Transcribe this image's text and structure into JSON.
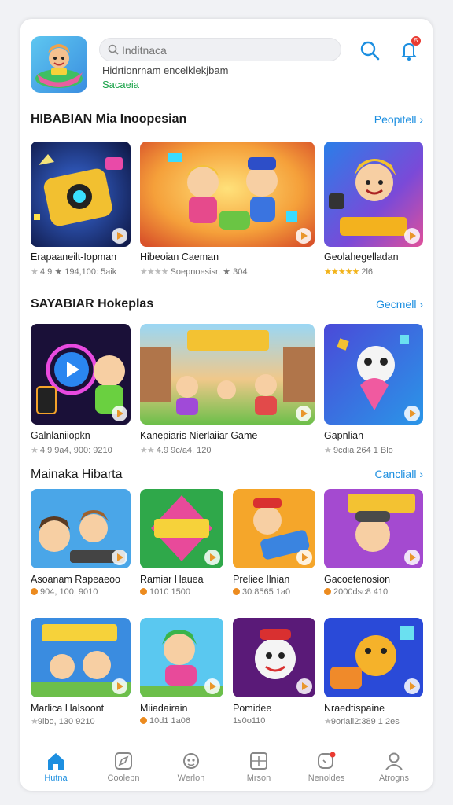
{
  "search": {
    "placeholder": "Inditnaca",
    "value": ""
  },
  "header": {
    "subtitle": "Hidrtionrnam encelklekjbam",
    "status": "Sacaeia",
    "notification_count": "5"
  },
  "sections": [
    {
      "title": "HIBABIAN Mia Inoopesian",
      "see_all": "Peopitell",
      "items": [
        {
          "name": "Erapaaneilt-Iopman",
          "meta": "4.9 ★ 194,100: 5aik"
        },
        {
          "name": "Hibeoian Caeman",
          "meta": "Soepnoesisr, ★ 304"
        },
        {
          "name": "Geolahegelladan",
          "meta": "2l6"
        }
      ]
    },
    {
      "title": "SAYABIAR Hokeplas",
      "see_all": "Gecmell",
      "items": [
        {
          "name": "Galnlaniiopkn",
          "meta": "4.9 9a4, 900: 9210"
        },
        {
          "name": "Kanepiaris Nierlaiiar Game",
          "meta": "4.9 9c/a4, 120"
        },
        {
          "name": "Gapnlian",
          "meta": "9cdia 264 1 Blo"
        }
      ]
    },
    {
      "title": "Mainaka Hibarta",
      "see_all": "Cancliall",
      "items": [
        {
          "name": "Asoanam Rapeaeoo",
          "meta": "904, 100, 9010"
        },
        {
          "name": "Ramiar Hauea",
          "meta": "1010 1500"
        },
        {
          "name": "Preliee Ilnian",
          "meta": "30:8565 1a0"
        },
        {
          "name": "Gacoetenosion",
          "meta": "2000dsc8 410"
        },
        {
          "name": "Marlica Halsoont",
          "meta": "9lbo, 130 9210"
        },
        {
          "name": "Miiadairain",
          "meta": "10d1 1a06"
        },
        {
          "name": "Pomidee",
          "meta": "1s0o110"
        },
        {
          "name": "Nraedtispaine",
          "meta": "9oriall2:389 1 2es"
        }
      ]
    }
  ],
  "bottom_nav": [
    {
      "label": "Hutna",
      "icon": "home-icon"
    },
    {
      "label": "Coolepn",
      "icon": "compass-icon"
    },
    {
      "label": "Werlon",
      "icon": "controller-icon"
    },
    {
      "label": "Mrson",
      "icon": "grid-icon"
    },
    {
      "label": "Nenoldes",
      "icon": "chat-icon"
    },
    {
      "label": "Atrogns",
      "icon": "profile-icon"
    }
  ],
  "colors": {
    "accent": "#1d8fe0",
    "badge": "#ea3b32",
    "status_green": "#1ba34a",
    "star": "#f2b31a"
  }
}
